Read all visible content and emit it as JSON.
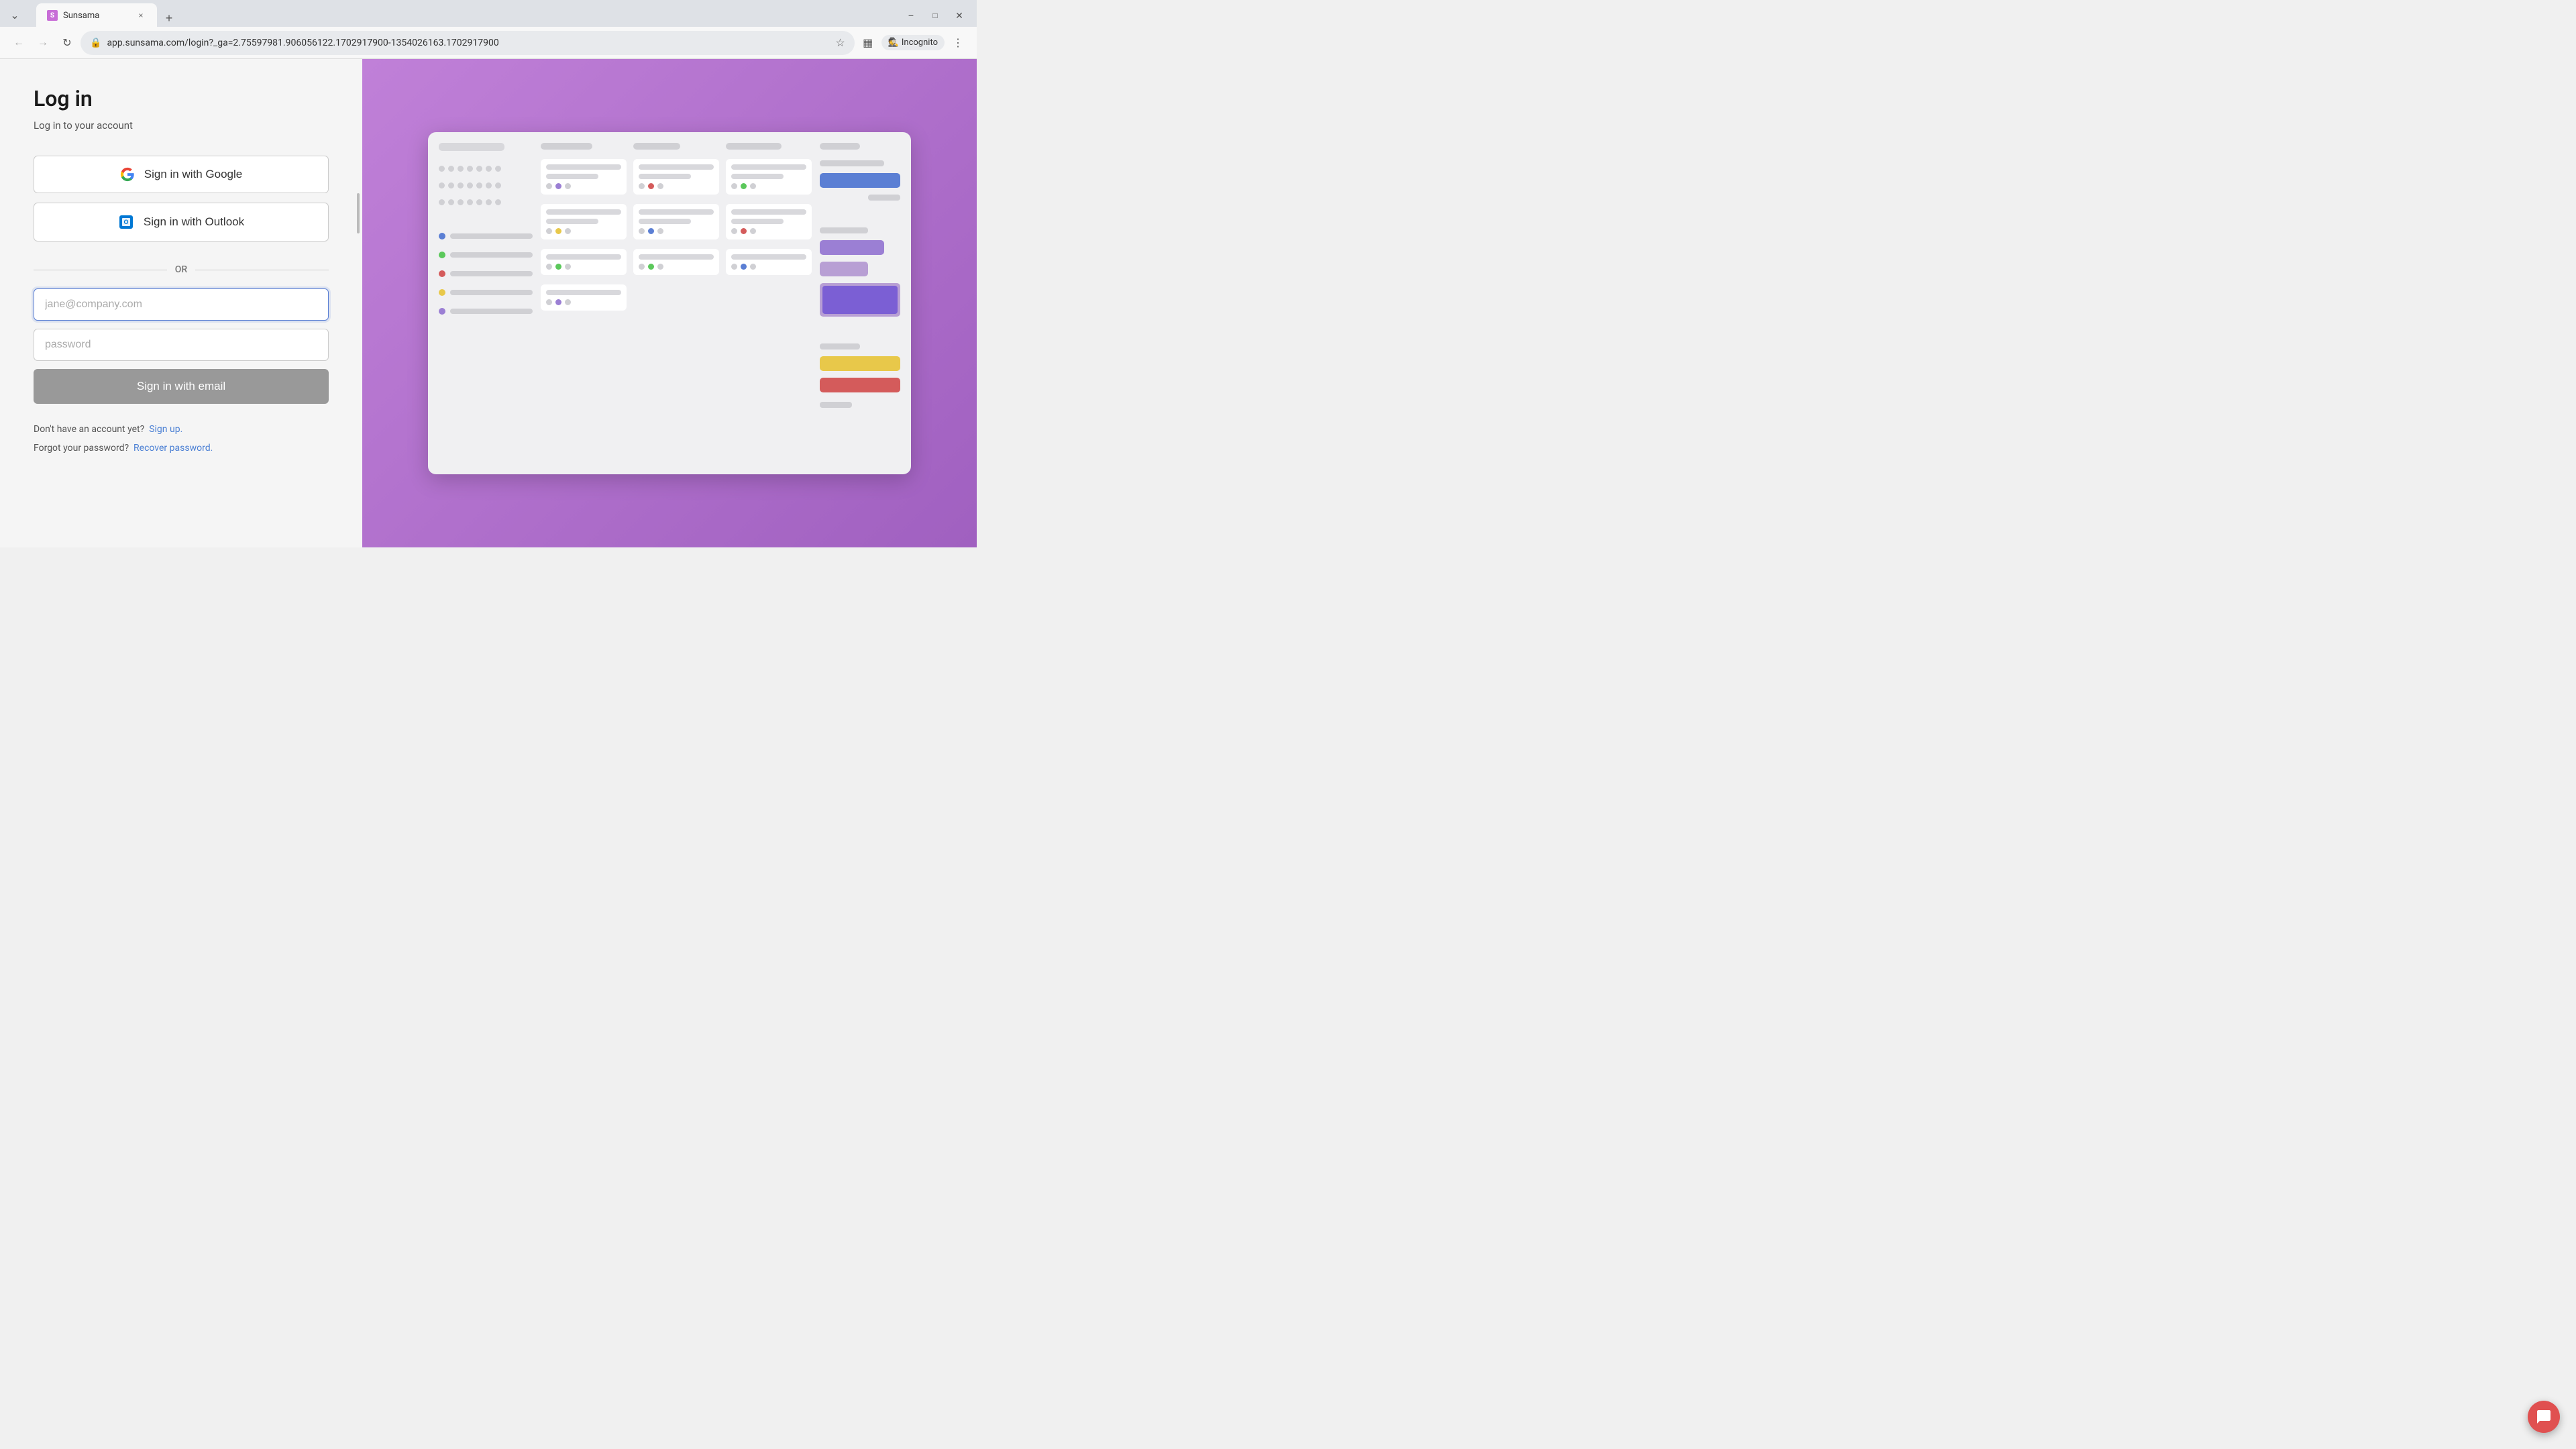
{
  "browser": {
    "tab": {
      "favicon_letter": "S",
      "title": "Sunsama",
      "close_label": "×",
      "new_tab_label": "+"
    },
    "toolbar": {
      "back_icon": "←",
      "forward_icon": "→",
      "refresh_icon": "↻",
      "url": "app.sunsama.com/login?_ga=2.75597981.906056122.1702917900-1354026163.1702917900",
      "star_icon": "☆",
      "sidebar_icon": "▦",
      "incognito_icon": "🕵",
      "incognito_label": "Incognito",
      "menu_icon": "⋮"
    }
  },
  "login": {
    "title": "Log in",
    "subtitle": "Log in to your account",
    "google_btn": "Sign in with Google",
    "outlook_btn": "Sign in with Outlook",
    "divider": "OR",
    "email_placeholder": "jane@company.com",
    "password_placeholder": "password",
    "submit_btn": "Sign in with email",
    "no_account_text": "Don't have an account yet?",
    "signup_link": "Sign up.",
    "forgot_text": "Forgot your password?",
    "recover_link": "Recover password."
  }
}
